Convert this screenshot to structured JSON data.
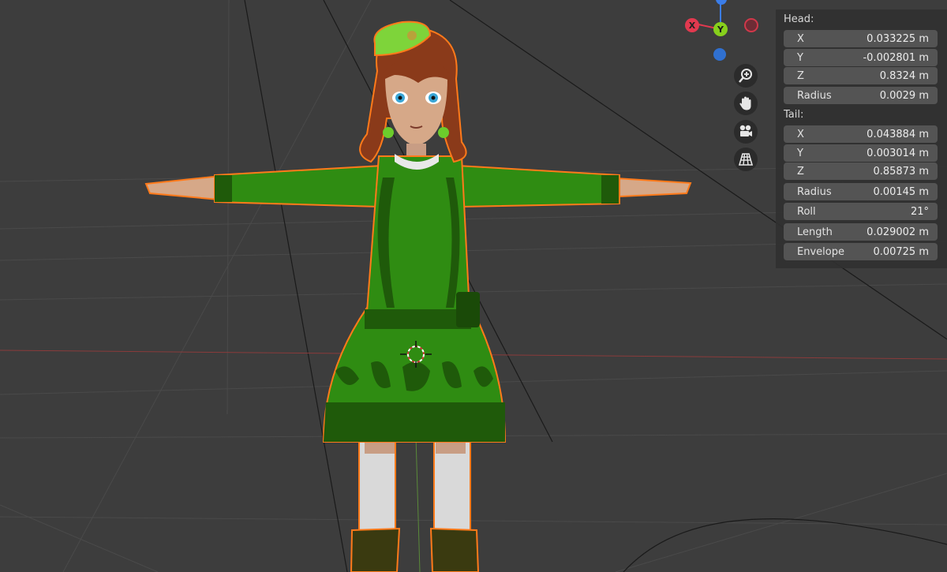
{
  "viewport": {
    "gizmo": {
      "x_label": "X",
      "y_label": "Y"
    },
    "nav_icons": [
      "zoom-icon",
      "hand-pan-icon",
      "camera-icon",
      "grid-perspective-icon"
    ]
  },
  "properties": {
    "head": {
      "title": "Head:",
      "x": {
        "label": "X",
        "value": "0.033225 m"
      },
      "y": {
        "label": "Y",
        "value": "-0.002801 m"
      },
      "z": {
        "label": "Z",
        "value": "0.8324 m"
      },
      "radius": {
        "label": "Radius",
        "value": "0.0029 m"
      }
    },
    "tail": {
      "title": "Tail:",
      "x": {
        "label": "X",
        "value": "0.043884 m"
      },
      "y": {
        "label": "Y",
        "value": "0.003014 m"
      },
      "z": {
        "label": "Z",
        "value": "0.85873 m"
      },
      "radius": {
        "label": "Radius",
        "value": "0.00145 m"
      }
    },
    "roll": {
      "label": "Roll",
      "value": "21°"
    },
    "length": {
      "label": "Length",
      "value": "0.029002 m"
    },
    "envelope": {
      "label": "Envelope",
      "value": "0.00725 m"
    }
  },
  "colors": {
    "background": "#3d3d3d",
    "outfit_green": "#2f8c12",
    "outfit_dark": "#1f5a0a",
    "selection_outline": "#ff7a1a",
    "axis_x": "#e2394f",
    "axis_y": "#87d01c",
    "axis_z": "#3b7de8"
  }
}
